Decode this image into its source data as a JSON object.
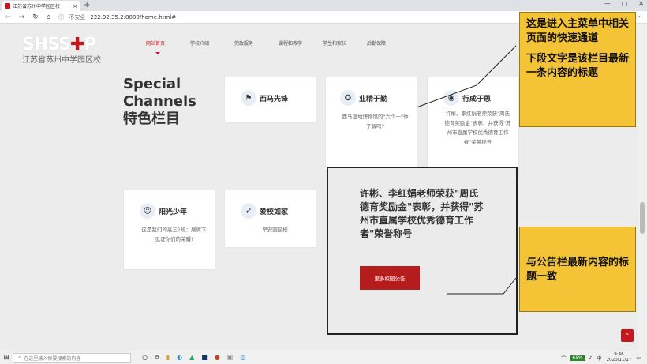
{
  "browser": {
    "tab_title": "江苏省苏州中学园区校",
    "tab_close": "×",
    "new_tab": "+",
    "security_label": "不安全",
    "url": "222.92.35.2:8080/home.html#",
    "win_min": "—",
    "win_max": "□",
    "win_close": "✕"
  },
  "site": {
    "logo_en": "SHSS",
    "logo_cn": "江苏省苏州中学园区校",
    "nav": [
      "网站首页",
      "学校介绍",
      "党政服务",
      "课程和教学",
      "学生和家长",
      "后勤保障"
    ],
    "section_title_en1": "Special",
    "section_title_en2": "Channels",
    "section_title_cn": "特色栏目"
  },
  "cards": [
    {
      "title": "西马先锋",
      "body": ""
    },
    {
      "title": "业精于勤",
      "body": "西马湿地博物馆的\"六个一\"你了解吗?"
    },
    {
      "title": "行成于思",
      "body": "许彬、李红娟老师荣获\"周氏德育奖励金\"表彰、并获得\"苏州市直属学校优秀德育工作者\"荣誉称号"
    },
    {
      "title": "阳光少年",
      "body": "这是我们的高三1班：展翼下见证你们的荣耀!"
    },
    {
      "title": "爱校如家",
      "body": "早安园区校"
    }
  ],
  "notice": {
    "text": "许彬、李红娟老师荣获\"周氏德育奖励金\"表彰，并获得\"苏州市直属学校优秀德育工作者\"荣誉称号",
    "button": "更多校园公告"
  },
  "annotations": {
    "a1": "这是进入主菜单中相关页面的快速通道",
    "a2": "下段文字是该栏目最新一条内容的标题",
    "a3": "与公告栏最新内容的标题一致"
  },
  "taskbar": {
    "search_placeholder": "在这里输入你要搜索的内容",
    "battery": "65%",
    "time": "9:46",
    "date": "2020/11/17"
  }
}
